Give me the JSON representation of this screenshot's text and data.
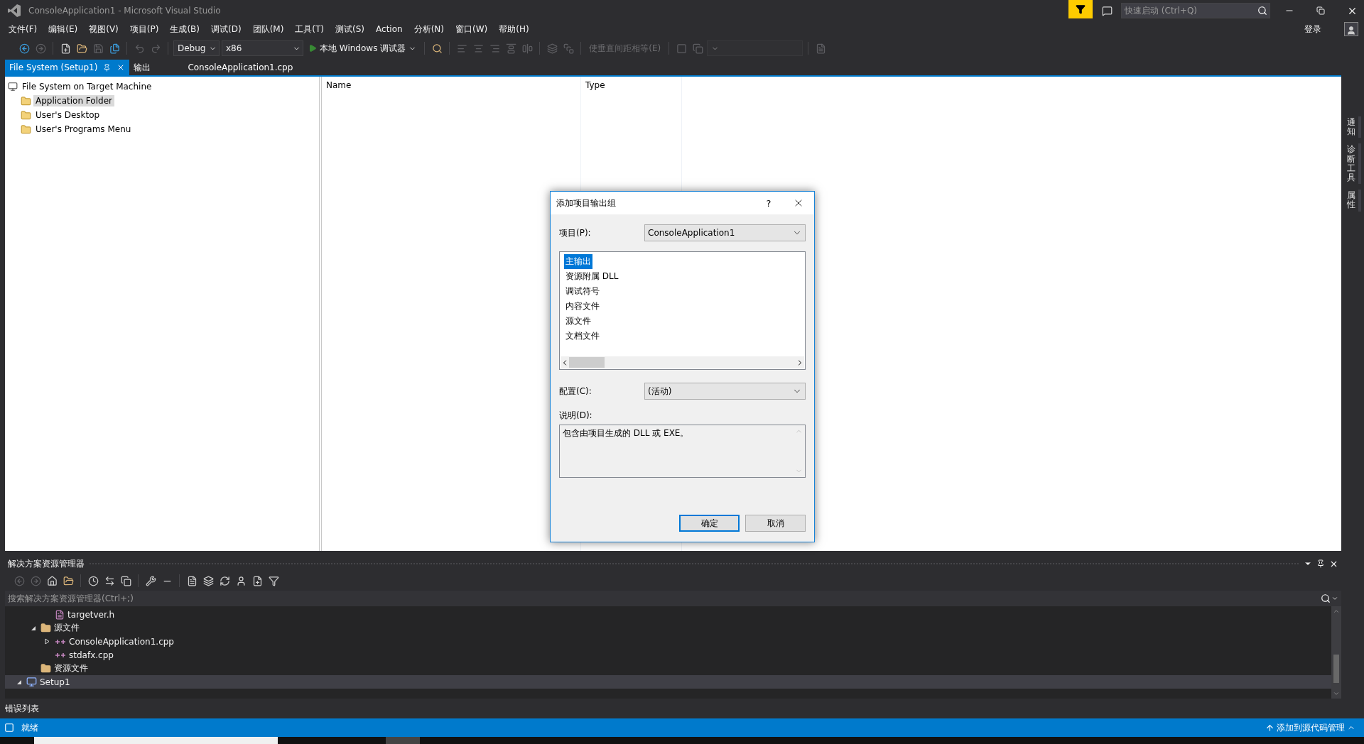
{
  "window": {
    "title": "ConsoleApplication1 - Microsoft Visual Studio"
  },
  "quick_launch": {
    "placeholder": "快速启动 (Ctrl+Q)"
  },
  "sign_in": "登录",
  "menu": [
    "文件(F)",
    "编辑(E)",
    "视图(V)",
    "项目(P)",
    "生成(B)",
    "调试(D)",
    "团队(M)",
    "工具(T)",
    "测试(S)",
    "Action",
    "分析(N)",
    "窗口(W)",
    "帮助(H)"
  ],
  "toolbar": {
    "configuration": "Debug",
    "platform": "x86",
    "debugger": "本地 Windows 调试器",
    "disabled_command": "使垂直间距相等(E)"
  },
  "document_tabs": [
    {
      "label": "File System (Setup1)",
      "selected": true
    },
    {
      "label": "输出",
      "selected": false
    },
    {
      "label": "ConsoleApplication1.cpp",
      "selected": false
    }
  ],
  "file_system": {
    "tree": [
      {
        "label": "File System on Target Machine",
        "kind": "machine",
        "selected": false,
        "children": [
          {
            "label": "Application Folder",
            "kind": "folder",
            "selected": true
          },
          {
            "label": "User's Desktop",
            "kind": "folder",
            "selected": false
          },
          {
            "label": "User's Programs Menu",
            "kind": "folder",
            "selected": false
          }
        ]
      }
    ],
    "columns": [
      "Name",
      "Type"
    ]
  },
  "side_tabs": [
    "通知",
    "诊断工具",
    "属性"
  ],
  "dialog": {
    "title": "添加项目输出组",
    "help": "?",
    "project_label": "项目(P):",
    "project": "ConsoleApplication1",
    "outputs": [
      {
        "label": "主输出",
        "selected": true
      },
      {
        "label": "资源附属 DLL",
        "selected": false
      },
      {
        "label": "调试符号",
        "selected": false
      },
      {
        "label": "内容文件",
        "selected": false
      },
      {
        "label": "源文件",
        "selected": false
      },
      {
        "label": "文档文件",
        "selected": false
      }
    ],
    "configuration_label": "配置(C):",
    "configuration": "(活动)",
    "description_label": "说明(D):",
    "description": "包含由项目生成的 DLL 或 EXE。",
    "buttons": [
      {
        "label": "确定",
        "default": true
      },
      {
        "label": "取消",
        "default": false
      }
    ]
  },
  "solution_explorer": {
    "title": "解决方案资源管理器",
    "search": {
      "placeholder": "搜索解决方案资源管理器(Ctrl+;)"
    },
    "tree": [
      {
        "children": [
          {
            "children": [
              {
                "label": "targetver.h",
                "kind": "header",
                "selected": false
              }
            ]
          },
          {
            "label": "源文件",
            "kind": "folder",
            "expanded": true,
            "selected": false,
            "children": [
              {
                "label": "ConsoleApplication1.cpp",
                "kind": "cpp",
                "expanded": false,
                "selected": false
              },
              {
                "label": "stdafx.cpp",
                "kind": "cpp",
                "selected": false
              }
            ]
          },
          {
            "label": "资源文件",
            "kind": "folder",
            "selected": false
          }
        ]
      },
      {
        "label": "Setup1",
        "kind": "project",
        "expanded": true,
        "selected": true
      }
    ]
  },
  "bottom_tabs": [
    "错误列表"
  ],
  "status_bar": {
    "text": "就绪",
    "source_control": "添加到源代码管理"
  }
}
